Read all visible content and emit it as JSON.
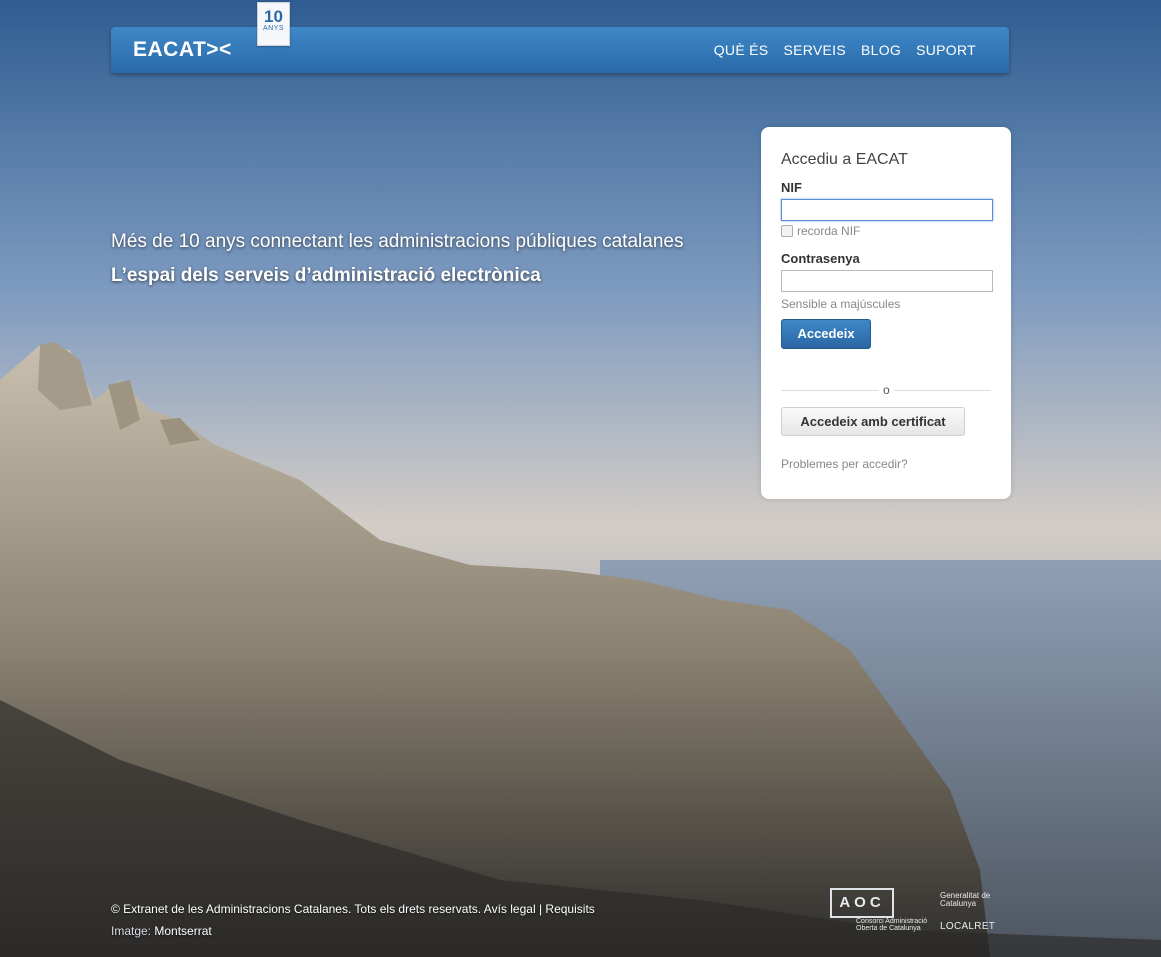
{
  "header": {
    "logo": "EACAT><",
    "badge_number": "10",
    "badge_label": "ANYS",
    "nav": [
      "QUÈ ÉS",
      "SERVEIS",
      "BLOG",
      "SUPORT"
    ]
  },
  "hero": {
    "line1": "Més de 10 anys connectant les administracions públiques catalanes",
    "line2": "L’espai dels serveis d’administració electrònica"
  },
  "login": {
    "title": "Accediu a EACAT",
    "nif_label": "NIF",
    "nif_value": "",
    "remember_label": "recorda NIF",
    "password_label": "Contrasenya",
    "password_value": "",
    "password_hint": "Sensible a majúscules",
    "submit_label": "Accedeix",
    "or_label": "o",
    "cert_label": "Accedeix amb certificat",
    "help_link": "Problemes per accedir?"
  },
  "footer": {
    "copyright": "© Extranet de les Administracions Catalanes. Tots els drets reservats.",
    "legal": "Avís legal",
    "separator": "|",
    "requirements": "Requisits",
    "image_label": "Imatge:",
    "image_name": "Montserrat"
  },
  "partners": {
    "aoc": "AOC",
    "aoc_sub": "Consorci Administració Oberta de Catalunya",
    "generalitat": "Generalitat de Catalunya",
    "localret": "LOCALRET"
  },
  "colors": {
    "brand_blue": "#2a6aa9",
    "accent_blue": "#3f88c8"
  }
}
